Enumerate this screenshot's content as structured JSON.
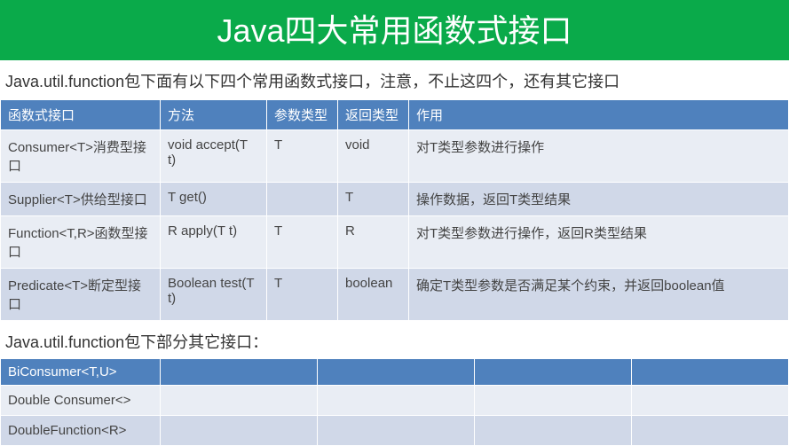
{
  "title": "Java四大常用函数式接口",
  "subtitle": "Java.util.function包下面有以下四个常用函数式接口，注意，不止这四个，还有其它接口",
  "table1": {
    "headers": [
      "函数式接口",
      "方法",
      "参数类型",
      "返回类型",
      "作用"
    ],
    "rows": [
      {
        "iface": "Consumer<T>消费型接口",
        "method": "void accept(T t)",
        "param": "T",
        "ret": "void",
        "desc": "对T类型参数进行操作"
      },
      {
        "iface": "Supplier<T>供给型接口",
        "method": "T get()",
        "param": "",
        "ret": "T",
        "desc": "操作数据，返回T类型结果"
      },
      {
        "iface": "Function<T,R>函数型接口",
        "method": "R apply(T t)",
        "param": "T",
        "ret": "R",
        "desc": "对T类型参数进行操作，返回R类型结果"
      },
      {
        "iface": "Predicate<T>断定型接口",
        "method": "Boolean test(T t)",
        "param": "T",
        "ret": "boolean",
        "desc": "确定T类型参数是否满足某个约束，并返回boolean值"
      }
    ]
  },
  "section2_title": "Java.util.function包下部分其它接口：",
  "table2": {
    "rows": [
      {
        "iface": "BiConsumer<T,U>",
        "c2": "",
        "c3": "",
        "c4": "",
        "c5": ""
      },
      {
        "iface": "Double Consumer<>",
        "c2": "",
        "c3": "",
        "c4": "",
        "c5": ""
      },
      {
        "iface": "DoubleFunction<R>",
        "c2": "",
        "c3": "",
        "c4": "",
        "c5": ""
      }
    ]
  }
}
